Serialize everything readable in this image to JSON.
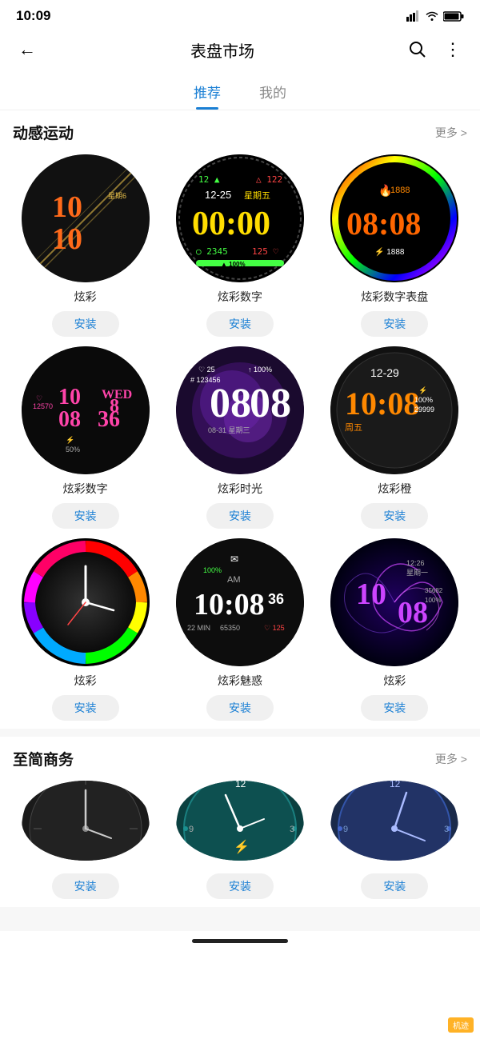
{
  "statusBar": {
    "time": "10:09",
    "locationIcon": true
  },
  "header": {
    "title": "表盘市场",
    "backLabel": "←",
    "searchLabel": "🔍",
    "moreLabel": "⋮"
  },
  "tabs": [
    {
      "label": "推荐",
      "active": true
    },
    {
      "label": "我的",
      "active": false
    }
  ],
  "sections": [
    {
      "id": "动感运动",
      "title": "动感运动",
      "more": "更多 >",
      "items": [
        {
          "name": "炫彩",
          "installLabel": "安装",
          "type": "dazzle1"
        },
        {
          "name": "炫彩数字",
          "installLabel": "安装",
          "type": "dazzle2"
        },
        {
          "name": "炫彩数字表盘",
          "installLabel": "安装",
          "type": "dazzle3"
        },
        {
          "name": "炫彩数字",
          "installLabel": "安装",
          "type": "dazzle4"
        },
        {
          "name": "炫彩时光",
          "installLabel": "安装",
          "type": "dazzle5"
        },
        {
          "name": "炫彩橙",
          "installLabel": "安装",
          "type": "dazzle6"
        },
        {
          "name": "炫彩",
          "installLabel": "安装",
          "type": "dazzle7"
        },
        {
          "name": "炫彩魅惑",
          "installLabel": "安装",
          "type": "dazzle8"
        },
        {
          "name": "炫彩",
          "installLabel": "安装",
          "type": "dazzle9"
        }
      ]
    },
    {
      "id": "至简商务",
      "title": "至简商务",
      "more": "更多 >",
      "items": [
        {
          "name": "",
          "installLabel": "安装",
          "type": "biz1"
        },
        {
          "name": "",
          "installLabel": "安装",
          "type": "biz2"
        },
        {
          "name": "",
          "installLabel": "安装",
          "type": "biz3"
        }
      ]
    }
  ],
  "navBar": {
    "indicator": "—"
  }
}
